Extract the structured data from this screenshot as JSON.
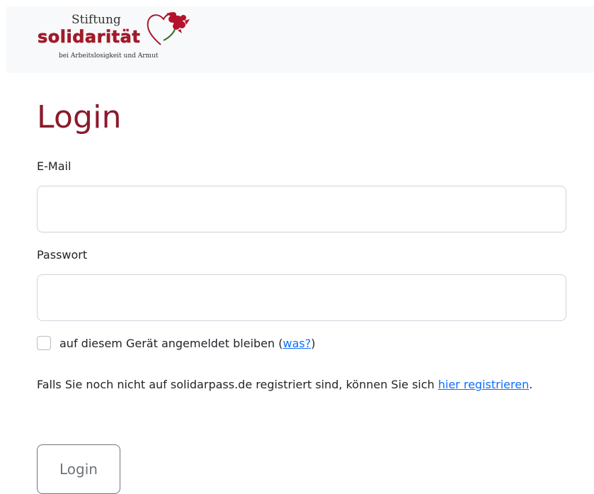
{
  "header": {
    "logo": {
      "line1": "Stiftung",
      "line2": "solidarität",
      "line3": "bei Arbeitslosigkeit und Armut"
    }
  },
  "main": {
    "title": "Login",
    "email_label": "E-Mail",
    "email_value": "",
    "password_label": "Passwort",
    "password_value": "",
    "remember_text": "auf diesem Gerät angemeldet bleiben (",
    "remember_link": "was?",
    "remember_suffix": ")",
    "register_text": "Falls Sie noch nicht auf solidarpass.de registriert sind, können Sie sich ",
    "register_link": "hier registrieren",
    "register_suffix": ".",
    "login_button": "Login"
  },
  "colors": {
    "brand": "#8b1a2b",
    "link": "#0d6efd",
    "header_bg": "#f8f9fa"
  }
}
